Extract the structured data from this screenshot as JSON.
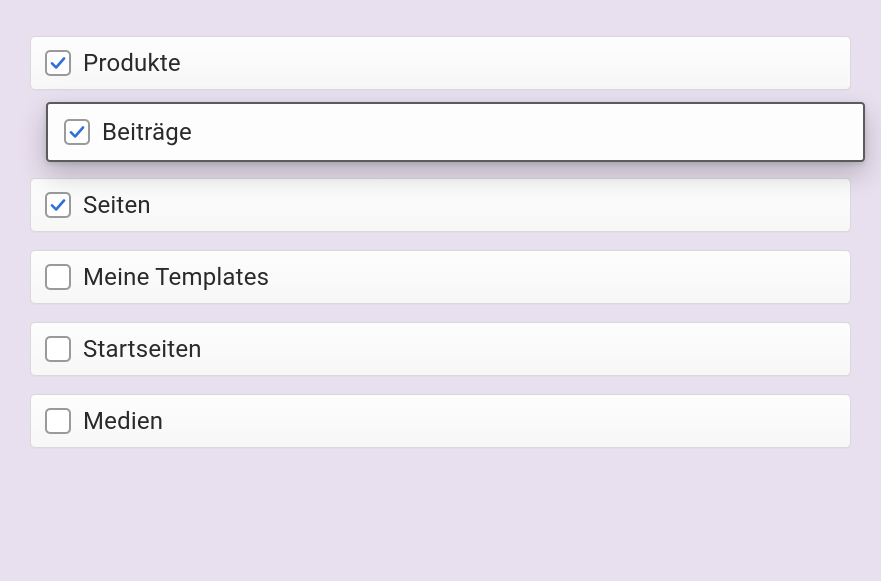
{
  "options": [
    {
      "label": "Produkte",
      "checked": true,
      "highlighted": false
    },
    {
      "label": "Beiträge",
      "checked": true,
      "highlighted": true
    },
    {
      "label": "Seiten",
      "checked": true,
      "highlighted": false
    },
    {
      "label": "Meine Templates",
      "checked": false,
      "highlighted": false
    },
    {
      "label": "Startseiten",
      "checked": false,
      "highlighted": false
    },
    {
      "label": "Medien",
      "checked": false,
      "highlighted": false
    }
  ],
  "colors": {
    "check": "#2f6fd8"
  }
}
